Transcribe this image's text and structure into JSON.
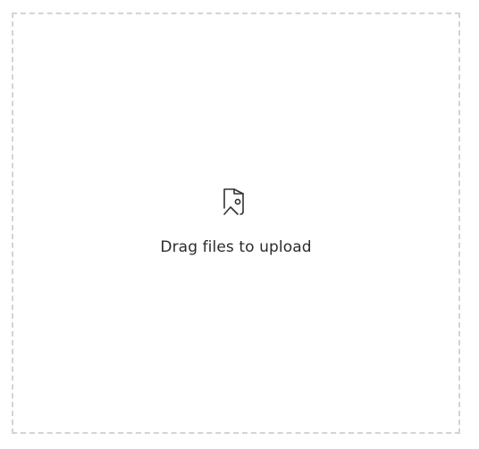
{
  "dropzone": {
    "icon": "image-file-icon",
    "label": "Drag files to upload"
  },
  "colors": {
    "border": "#d4d4d4",
    "text": "#2b2b2b",
    "icon": "#333333"
  }
}
